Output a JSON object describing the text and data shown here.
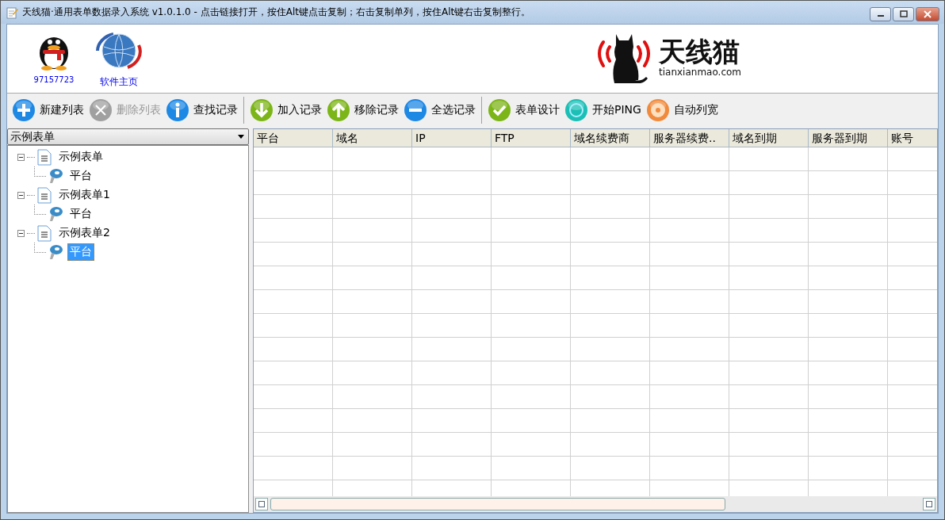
{
  "window": {
    "title": "天线猫·通用表单数据录入系统 v1.0.1.0 - 点击链接打开，按住Alt键点击复制；右击复制单列，按住Alt键右击复制整行。"
  },
  "header": {
    "links": [
      {
        "label": "97157723"
      },
      {
        "label": "软件主页"
      }
    ],
    "logo": {
      "name": "天线猫",
      "domain": "tianxianmao.com"
    }
  },
  "toolbar": [
    {
      "kind": "button",
      "label": "新建列表",
      "disabled": false
    },
    {
      "kind": "button",
      "label": "删除列表",
      "disabled": true
    },
    {
      "kind": "button",
      "label": "查找记录",
      "disabled": false
    },
    {
      "kind": "separator"
    },
    {
      "kind": "button",
      "label": "加入记录",
      "disabled": false
    },
    {
      "kind": "button",
      "label": "移除记录",
      "disabled": false
    },
    {
      "kind": "button",
      "label": "全选记录",
      "disabled": false
    },
    {
      "kind": "separator"
    },
    {
      "kind": "button",
      "label": "表单设计",
      "disabled": false
    },
    {
      "kind": "button",
      "label": "开始PING",
      "disabled": false
    },
    {
      "kind": "button",
      "label": "自动列宽",
      "disabled": false
    }
  ],
  "form_select": {
    "value": "示例表单"
  },
  "tree": [
    {
      "label": "示例表单",
      "expanded": true,
      "children": [
        {
          "label": "平台",
          "selected": false
        }
      ]
    },
    {
      "label": "示例表单1",
      "expanded": true,
      "children": [
        {
          "label": "平台",
          "selected": false
        }
      ]
    },
    {
      "label": "示例表单2",
      "expanded": true,
      "children": [
        {
          "label": "平台",
          "selected": true
        }
      ]
    }
  ],
  "table": {
    "columns": [
      "平台",
      "域名",
      "IP",
      "FTP",
      "域名续费商",
      "服务器续费..",
      "域名到期",
      "服务器到期",
      "账号"
    ]
  }
}
